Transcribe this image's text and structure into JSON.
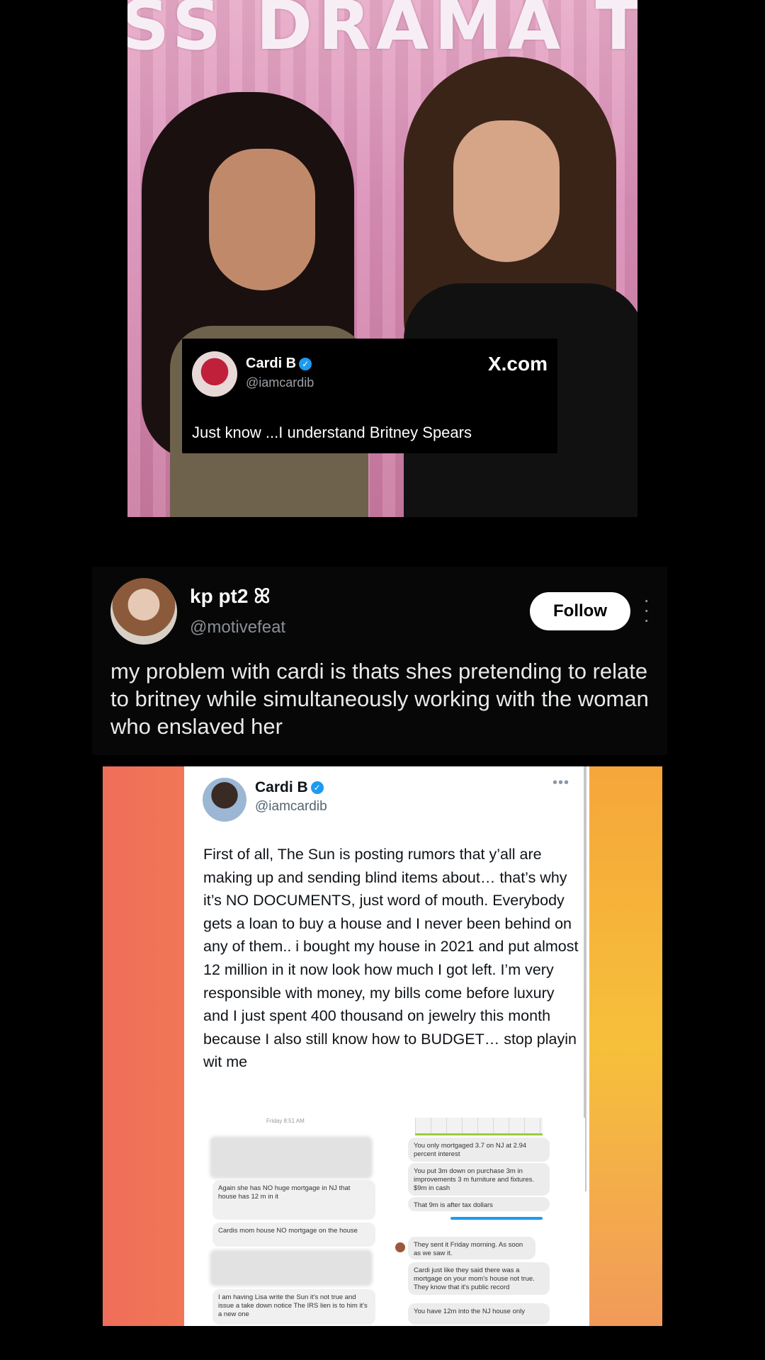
{
  "photo": {
    "banner": "SS DRAMA T",
    "embedded_post": {
      "name": "Cardi B",
      "handle": "@iamcardib",
      "brand": "X.com",
      "text": "Just know ...I understand Britney Spears"
    }
  },
  "tweet": {
    "name": "kp pt2 ꕤ",
    "handle": "@motivefeat",
    "follow_label": "Follow",
    "body": "my problem with cardi is thats shes  pretending to relate to britney while simultaneously working with the woman who enslaved her"
  },
  "screenshot_post": {
    "name": "Cardi B",
    "handle": "@iamcardib",
    "more": "•••",
    "body": "First of all, The Sun is posting rumors that y’all are making up and sending blind items about… that’s why it’s NO DOCUMENTS, just word of mouth. Everybody gets a loan to buy a house and I never been behind on any of them.. i bought my house in 2021 and put almost 12 million in it now look how much I got left.  I’m very responsible with money, my bills come before luxury and I just spent 400 thousand on jewelry this month because I also still know how to BUDGET… stop playin wit me",
    "left_messages": {
      "time": "Friday 8:51 AM",
      "msg1": "Again she has NO huge mortgage in NJ that house has 12 m in it",
      "msg2": "Cardis mom house NO mortgage on the house",
      "msg3": "I am having Lisa write the Sun it's not true and issue a take down notice The IRS lien is to him it's a new one"
    },
    "right_messages": {
      "msg1": "You only mortgaged 3.7 on NJ at 2.94 percent interest",
      "msg2": "You put 3m down on purchase 3m in improvements 3 m furniture and fixtures. $9m in cash",
      "msg3": "That 9m is after tax dollars",
      "msg4": "They sent it Friday morning. As soon as we saw it.",
      "msg5": "Cardi just like they said there was a mortgage on your mom's house not true. They know that it's public record",
      "msg6": "You have 12m into the NJ house only"
    }
  }
}
